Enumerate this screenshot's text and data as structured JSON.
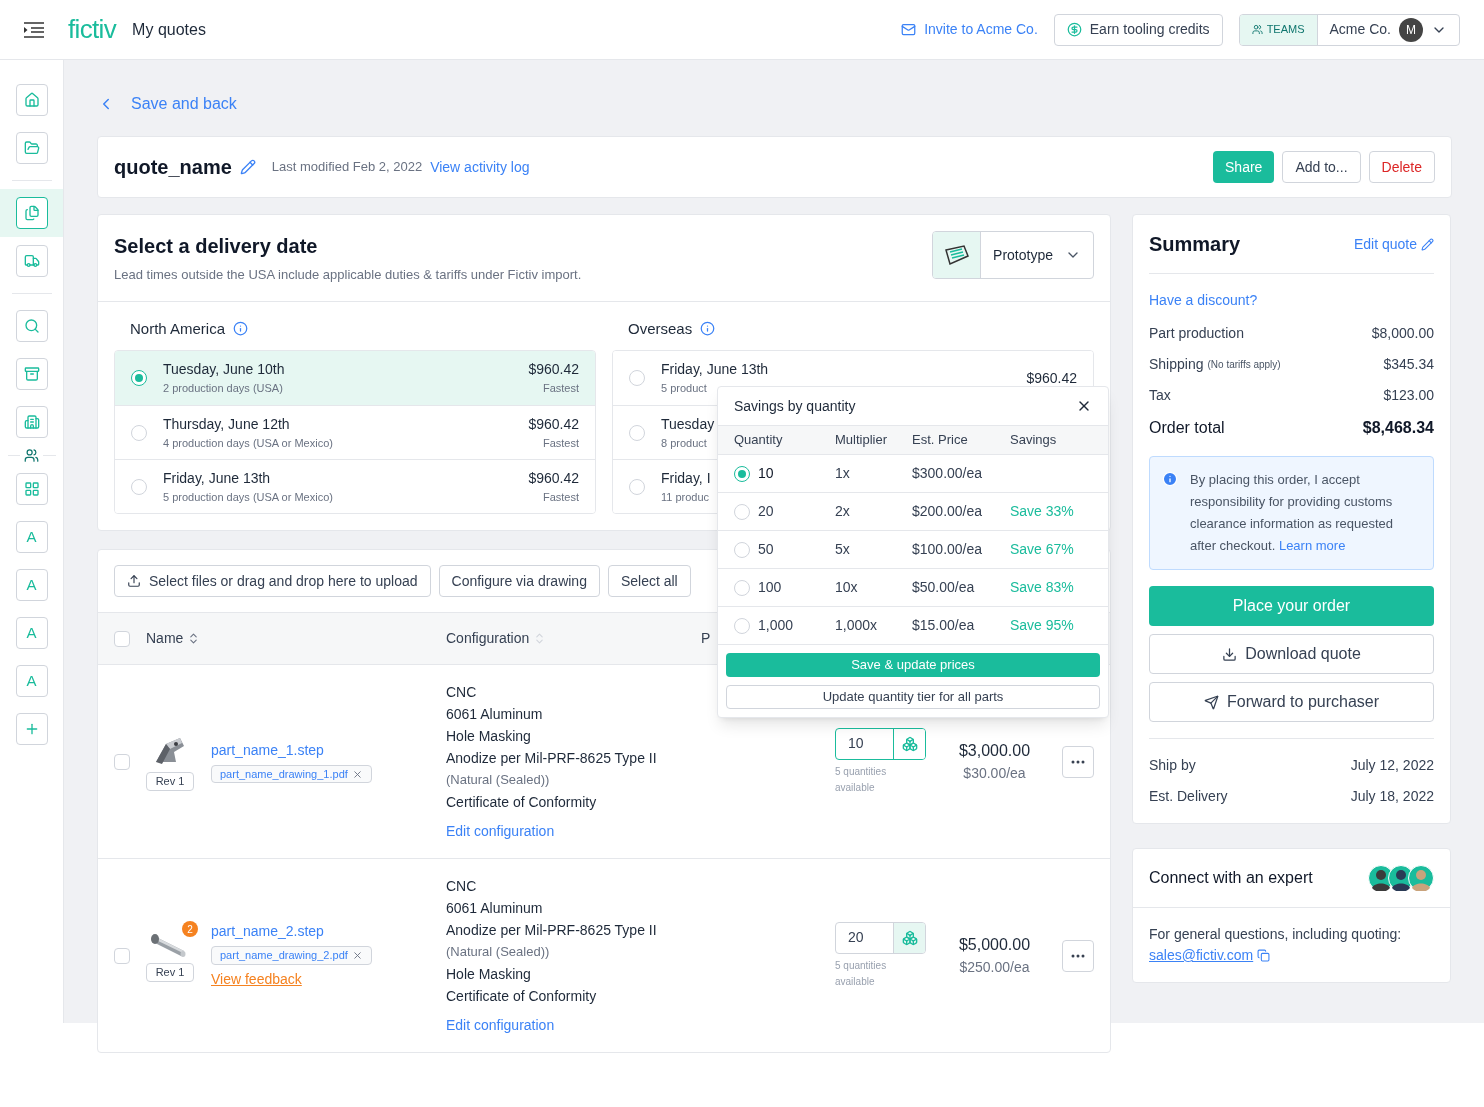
{
  "header": {
    "logo": "fictiv",
    "title": "My quotes",
    "invite": "Invite to Acme Co.",
    "credits": "Earn tooling credits",
    "teams": "TEAMS",
    "org": "Acme Co.",
    "avatar": "M"
  },
  "sidebar": {
    "items": [
      {
        "kind": "icon",
        "selected": false
      },
      {
        "kind": "icon",
        "selected": false
      },
      {
        "kind": "icon",
        "selected": true
      },
      {
        "kind": "icon",
        "selected": false
      },
      {
        "kind": "icon",
        "selected": false
      },
      {
        "kind": "icon",
        "selected": false
      },
      {
        "kind": "icon",
        "selected": false
      },
      {
        "kind": "icon",
        "selected": false
      },
      {
        "kind": "letter",
        "letter": "A",
        "selected": false
      },
      {
        "kind": "letter",
        "letter": "A",
        "selected": false
      },
      {
        "kind": "letter",
        "letter": "A",
        "selected": false
      },
      {
        "kind": "letter",
        "letter": "A",
        "selected": false
      },
      {
        "kind": "icon",
        "selected": false
      }
    ]
  },
  "back": "Save and back",
  "quote": {
    "name": "quote_name",
    "modified": "Last modified Feb 2, 2022",
    "activity": "View activity log",
    "buttons": [
      "Share",
      "Add to...",
      "Delete"
    ]
  },
  "delivery": {
    "title": "Select a delivery date",
    "subtitle": "Lead times outside the USA include applicable duties & tariffs under Fictiv import.",
    "process": "Prototype",
    "regions": [
      {
        "name": "North America",
        "options": [
          {
            "date": "Tuesday, June 10th",
            "detail": "2 production days (USA)",
            "price": "$960.42",
            "tag": "Fastest",
            "selected": true
          },
          {
            "date": "Thursday, June 12th",
            "detail": "4 production days (USA or Mexico)",
            "price": "$960.42",
            "tag": "Fastest",
            "selected": false
          },
          {
            "date": "Friday, June 13th",
            "detail": "5 production days (USA or Mexico)",
            "price": "$960.42",
            "tag": "Fastest",
            "selected": false
          }
        ]
      },
      {
        "name": "Overseas",
        "options": [
          {
            "date": "Friday, June 13th",
            "detail": "5 product",
            "price": "$960.42",
            "selected": false
          },
          {
            "date": "Tuesday",
            "detail": "8 product",
            "selected": false
          },
          {
            "date": "Friday, I",
            "detail": "11 produc",
            "selected": false
          }
        ]
      }
    ]
  },
  "parts": {
    "toolbar": [
      "Select files or drag and drop here to upload",
      "Configure via drawing",
      "Select all"
    ],
    "columns": [
      "Name",
      "Configuration",
      "P"
    ],
    "all_checked": false,
    "rows": [
      {
        "checked": false,
        "file": "part_name_1.step",
        "drawing": "part_name_drawing_1.pdf",
        "rev": "Rev 1",
        "config": [
          {
            "kind": "main",
            "text": "CNC"
          },
          {
            "kind": "main",
            "text": "6061 Aluminum"
          },
          {
            "kind": "main",
            "text": "Hole Masking"
          },
          {
            "kind": "main",
            "text": "Anodize per Mil-PRF-8625 Type II"
          },
          {
            "kind": "note",
            "text": "(Natural (Sealed))"
          },
          {
            "kind": "main",
            "text": "Certificate of Conformity"
          }
        ],
        "edit": "Edit configuration",
        "quantity": "10",
        "active": true,
        "available": "5 quantities available",
        "total": "$3,000.00",
        "each": "$30.00/ea"
      },
      {
        "checked": false,
        "badge": "2",
        "file": "part_name_2.step",
        "drawing": "part_name_drawing_2.pdf",
        "rev": "Rev 1",
        "feedback": "View feedback",
        "config": [
          {
            "kind": "main",
            "text": "CNC"
          },
          {
            "kind": "main",
            "text": "6061 Aluminum"
          },
          {
            "kind": "main",
            "text": "Anodize per Mil-PRF-8625 Type II"
          },
          {
            "kind": "note",
            "text": "(Natural (Sealed))"
          },
          {
            "kind": "main",
            "text": "Hole Masking"
          },
          {
            "kind": "main",
            "text": "Certificate of Conformity"
          }
        ],
        "edit": "Edit configuration",
        "quantity": "20",
        "active": false,
        "available": "5 quantities available",
        "total": "$5,000.00",
        "each": "$250.00/ea"
      }
    ]
  },
  "savings": {
    "title": "Savings by quantity",
    "columns": [
      "Quantity",
      "Multiplier",
      "Est. Price",
      "Savings"
    ],
    "tiers": [
      {
        "quantity": "10",
        "multiplier": "1x",
        "price": "$300.00/ea",
        "selected": true
      },
      {
        "quantity": "20",
        "multiplier": "2x",
        "price": "$200.00/ea",
        "savings": "Save 33%",
        "selected": false
      },
      {
        "quantity": "50",
        "multiplier": "5x",
        "price": "$100.00/ea",
        "savings": "Save 67%",
        "selected": false
      },
      {
        "quantity": "100",
        "multiplier": "10x",
        "price": "$50.00/ea",
        "savings": "Save 83%",
        "selected": false
      },
      {
        "quantity": "1,000",
        "multiplier": "1,000x",
        "price": "$15.00/ea",
        "savings": "Save 95%",
        "selected": false
      }
    ],
    "primary": "Save & update prices",
    "secondary": "Update quantity tier for all parts"
  },
  "summary": {
    "title": "Summary",
    "edit": "Edit quote",
    "discount": "Have a discount?",
    "lines": [
      {
        "label": "Part production",
        "value": "$8,000.00"
      },
      {
        "label": "Shipping",
        "note": "(No tariffs apply)",
        "value": "$345.34"
      },
      {
        "label": "Tax",
        "value": "$123.00"
      }
    ],
    "total": {
      "label": "Order total",
      "value": "$8,468.34"
    },
    "notice": "By placing this order, I accept responsibility for providing customs clearance information as requested after checkout.",
    "learn": "Learn more",
    "place": "Place your order",
    "download": "Download quote",
    "forward": "Forward to purchaser",
    "dates": [
      {
        "label": "Ship by",
        "value": "July 12, 2022"
      },
      {
        "label": "Est. Delivery",
        "value": "July 18, 2022"
      }
    ]
  },
  "expert": {
    "title": "Connect with an expert",
    "text": "For general questions, including quoting:",
    "email": "sales@fictiv.com"
  }
}
